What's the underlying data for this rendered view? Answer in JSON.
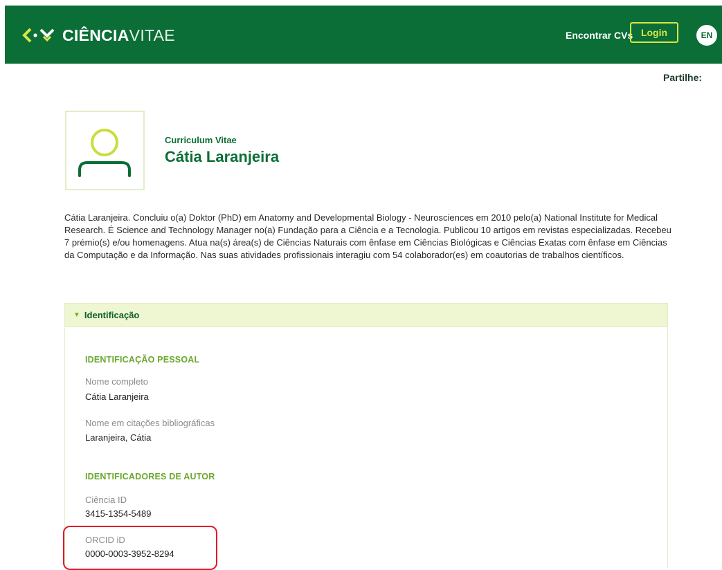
{
  "header": {
    "logo_bold": "CIÊNCIA",
    "logo_light": "VITAE",
    "nav_find": "Encontrar CVs",
    "login_label": "Login",
    "lang_label": "EN",
    "brand_color": "#0b6e36",
    "accent_color": "#d8e646"
  },
  "share_label": "Partilhe:",
  "profile": {
    "avatar_icon": "user-icon",
    "cv_label": "Curriculum Vitae",
    "name": "Cátia Laranjeira",
    "summary": "Cátia Laranjeira. Concluiu o(a) Doktor (PhD) em Anatomy and Developmental Biology - Neurosciences em 2010 pelo(a) National Institute for Medical Research. É Science and Technology Manager no(a) Fundação para a Ciência e a Tecnologia. Publicou 10 artigos em revistas especializadas. Recebeu 7 prémio(s) e/ou homenagens. Atua na(s) área(s) de Ciências Naturais com ênfase em Ciências Biológicas e Ciências Exatas com ênfase em Ciências da Computação e da Informação. Nas suas atividades profissionais interagiu com 54 colaborador(es) em coautorias de trabalhos científicos."
  },
  "identification": {
    "title": "Identificação",
    "personal_heading": "IDENTIFICAÇÃO PESSOAL",
    "full_name_label": "Nome completo",
    "full_name_value": "Cátia Laranjeira",
    "citation_label": "Nome em citações bibliográficas",
    "citation_value": "Laranjeira, Cátia",
    "author_ids_heading": "IDENTIFICADORES DE AUTOR",
    "ciencia_id_label": "Ciência ID",
    "ciencia_id_value": "3415-1354-5489",
    "orcid_label": "ORCID iD",
    "orcid_value": "0000-0003-3952-8294"
  },
  "annotation_color": "#e0192d"
}
